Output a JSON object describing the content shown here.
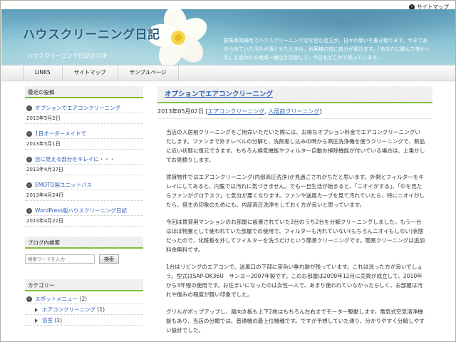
{
  "top": {
    "sitemap_label": "サイトマップ"
  },
  "header": {
    "title": "ハウスクリーニング日記",
    "subtitle": "ハウスクリーニング日記のTOP",
    "description": "群馬県高崎市でハウスクリーニング店を営む店主が、日々の思いを書き綴ります。今まであきらめていた汚れが落とせたときは、お客様の前に自分が喜びます。「あなたに頼んで良かった」と言われる地域一番店を目指して、今日もどこかで洗っています。"
  },
  "nav": {
    "items": [
      "LINKS",
      "サイトマップ",
      "サンプルページ"
    ]
  },
  "sidebar": {
    "recent_title": "最近の投稿",
    "recent": [
      {
        "title": "オプションでエアコンクリーニング",
        "date": "2013年5月2日"
      },
      {
        "title": "1日オーダーメイドで",
        "date": "2013年5月1日"
      },
      {
        "title": "目に見える部分をキレイに・・・",
        "date": "2013年4月27日"
      },
      {
        "title": "EMOTO製ユニットバス",
        "date": "2013年4月24日"
      },
      {
        "title": "WordPress版ハウスクリーニング日記",
        "date": "2013年4月22日"
      }
    ],
    "search_title": "ブログ内検索",
    "search_placeholder": "検索ワードを入力",
    "search_button": "検索",
    "category_title": "カテゴリー",
    "categories": [
      {
        "name": "スポットメニュー",
        "count": "(2)"
      }
    ],
    "subcategories": [
      {
        "name": "エアコンクリーニング",
        "count": "(1)"
      },
      {
        "name": "浴室",
        "count": "(1)"
      }
    ]
  },
  "post": {
    "title": "オプションでエアコンクリーニング",
    "date": "2013年05月02日",
    "cat_open": "[",
    "cat1": "エアコンクリーニング",
    "cat_sep": ", ",
    "cat2": "入居前クリーニング",
    "cat_close": "]",
    "paragraphs": [
      "当店の入居前クリーニングをご用命いただいた際には、お得なオプション料金でエアコンクリーニングいたします。ファンまで外すレベルの分解と、洗剤差し込みの時から高圧洗浄機を使うクリーニングで、新品に近い状態に復元できます。もちろん換気機能やフィルター自動お掃除機能が付いている場合は、上乗せしてお見積りします。",
      "賃貸物件ではエアコンクリーニング(内部高圧洗浄)が見過ごされがちだと思います。外側とフィルターをキレイにしてあると、内覧では汚れに気づきません。でも一旦生活が始まると、「ニオイがする」、「中を見たらファンがグロテスク」と気分が悪くなります。ファンや送風カーブを見て汚れていたら、特にニオイがしたら、借主の印象のためにも、内部高圧洗浄をしておく方が良いと思っています。",
      "今回は賃貸用マンションのお部屋に設置されていた3台のうち2台を分解クリーニングしました。もう一台はほぼ物置として使われていた部屋での使用で、フィルターも汚れていない(もちろんニオイもしない)状態だったので、化粧板を外してフィルターを洗うだけという簡易クリーニングです。簡易クリーニングは追加料金無料です。",
      "1台はリビングのエアコンで、送風口の下部に茶色い垂れ跡が残っています。これは洗った方が良いでしょう。型式はSAP-DK36U　サンヨー2007年製です。このお部屋は2009年12月に売買が成立して、2010年から3年程の使用です。お住まいになったのは女性一人で、あまり使われていなかったらしく、お部屋は汚れや傷みの程度が軽い印象でした。",
      "グリルがポップアップし、風向き板も上下2枚はもちろん左右までモーター駆動します。電気式空気清浄機能もあり、当店の分類では、普通機の最上位機種です。ですが予想していた通り、分かりやすく分解しやすい設計でした。"
    ]
  }
}
